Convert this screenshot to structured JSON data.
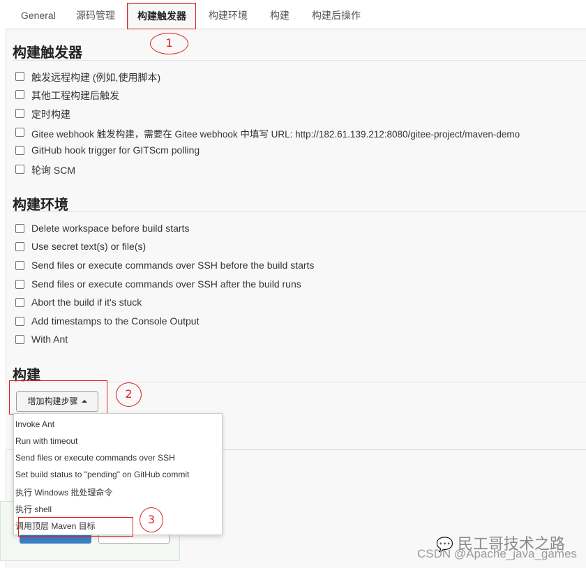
{
  "tabs": [
    {
      "label": "General"
    },
    {
      "label": "源码管理"
    },
    {
      "label": "构建触发器"
    },
    {
      "label": "构建环境"
    },
    {
      "label": "构建"
    },
    {
      "label": "构建后操作"
    }
  ],
  "annotations": [
    "1",
    "2",
    "3"
  ],
  "triggers": {
    "title": "构建触发器",
    "items": [
      "触发远程构建 (例如,使用脚本)",
      "其他工程构建后触发",
      "定时构建",
      "Gitee webhook 触发构建，需要在 Gitee webhook 中填写 URL: http://182.61.139.212:8080/gitee-project/maven-demo",
      "GitHub hook trigger for GITScm polling",
      "轮询 SCM"
    ]
  },
  "env": {
    "title": "构建环境",
    "items": [
      "Delete workspace before build starts",
      "Use secret text(s) or file(s)",
      "Send files or execute commands over SSH before the build starts",
      "Send files or execute commands over SSH after the build runs",
      "Abort the build if it's stuck",
      "Add timestamps to the Console Output",
      "With Ant"
    ]
  },
  "build": {
    "title": "构建",
    "add_step_label": "增加构建步骤",
    "menu": [
      "Invoke Ant",
      "Run with timeout",
      "Send files or execute commands over SSH",
      "Set build status to \"pending\" on GitHub commit",
      "执行 Windows 批处理命令",
      "执行 shell",
      "调用顶层 Maven 目标"
    ]
  },
  "watermark": {
    "wechat": "民工哥技术之路",
    "csdn": "CSDN @Apache_java_games"
  },
  "colors": {
    "annotation_red": "#e02020",
    "primary_button": "#3a7fc4"
  }
}
